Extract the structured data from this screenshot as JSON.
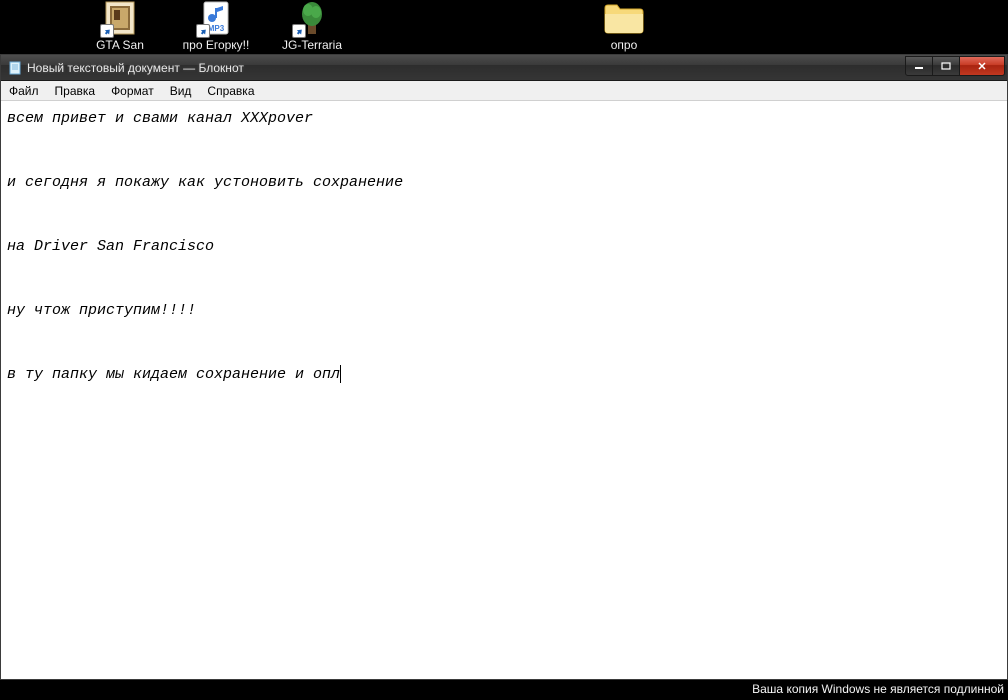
{
  "desktop": {
    "icons": [
      {
        "name": "gta-shortcut",
        "label": "GTA San",
        "type": "image-shortcut"
      },
      {
        "name": "mp3-shortcut",
        "label": "про Егорку!!",
        "type": "mp3-shortcut"
      },
      {
        "name": "terraria-shortcut",
        "label": "JG-Terraria",
        "type": "app-shortcut"
      },
      {
        "name": "opro-folder",
        "label": "опро",
        "type": "folder"
      }
    ]
  },
  "notepad": {
    "title": "Новый текстовый документ — Блокнот",
    "menu": {
      "file": "Файл",
      "edit": "Правка",
      "format": "Формат",
      "view": "Вид",
      "help": "Справка"
    },
    "content": "всем привет и свами канал XXXpover\n\nи сегодня я покажу как устоновить сохранение\n\nна Driver San Francisco\n\nну чтож приступим!!!!\n\nв ту папку мы кидаем сохранение и опл"
  },
  "watermark": "Ваша копия Windows не является подлинной"
}
